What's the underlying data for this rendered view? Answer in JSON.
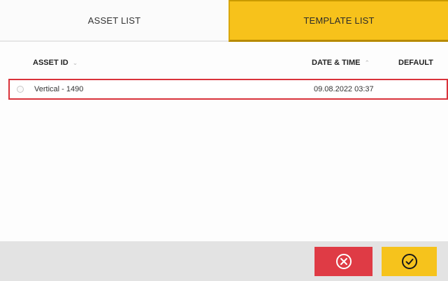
{
  "tabs": [
    {
      "label": "ASSET LIST",
      "active": false
    },
    {
      "label": "TEMPLATE LIST",
      "active": true
    }
  ],
  "table": {
    "columns": {
      "asset_id": "ASSET ID",
      "date_time": "DATE & TIME",
      "default": "DEFAULT"
    },
    "rows": [
      {
        "asset_id": "Vertical - 1490",
        "date_time": "09.08.2022 03:37",
        "default": "",
        "selected": true
      }
    ]
  },
  "actions": {
    "cancel_icon": "cancel-circle-icon",
    "confirm_icon": "check-circle-icon"
  },
  "colors": {
    "accent_yellow": "#f7c21b",
    "cancel_red": "#df3b45",
    "selection_border": "#d9323a",
    "bottom_bar": "#e3e3e3"
  }
}
